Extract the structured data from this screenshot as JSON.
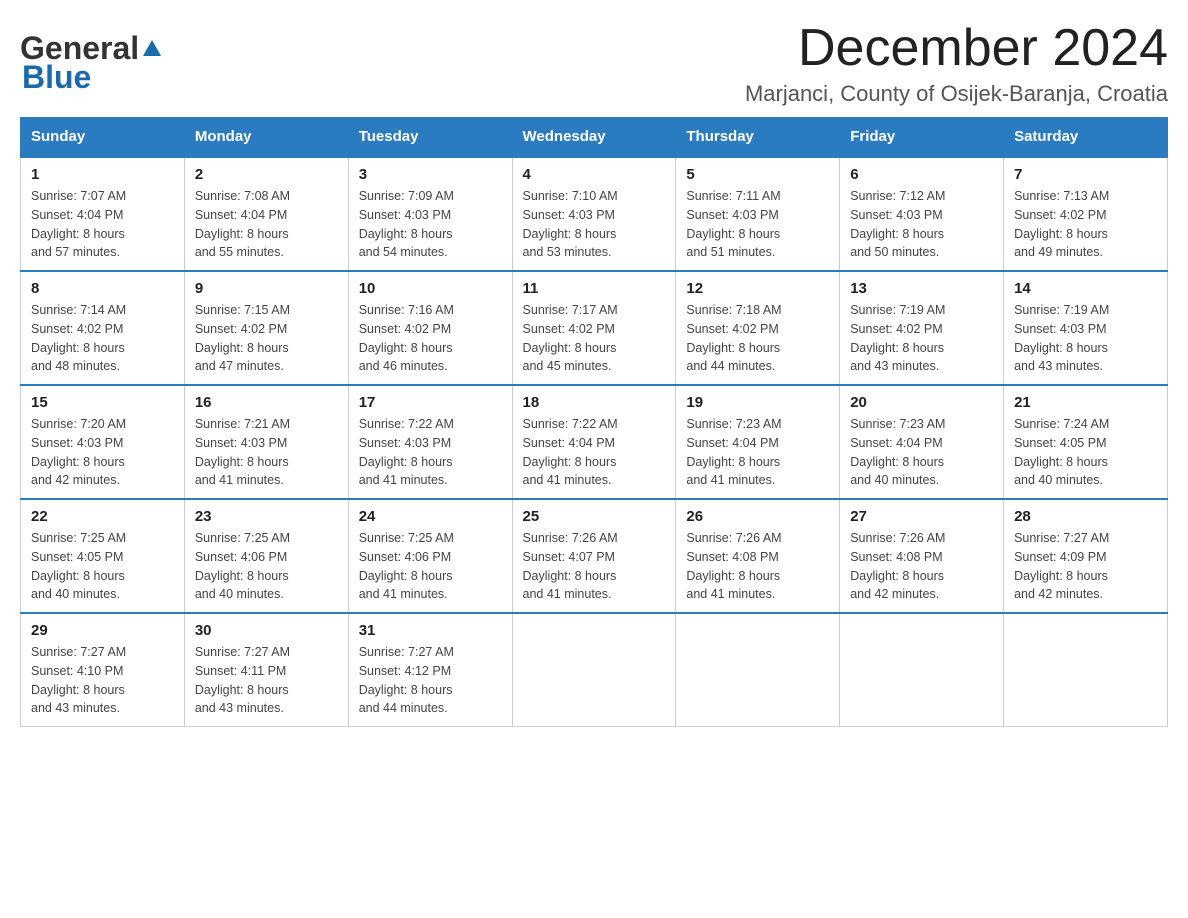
{
  "header": {
    "logo_general": "General",
    "logo_blue": "Blue",
    "month_title": "December 2024",
    "location": "Marjanci, County of Osijek-Baranja, Croatia"
  },
  "days_of_week": [
    "Sunday",
    "Monday",
    "Tuesday",
    "Wednesday",
    "Thursday",
    "Friday",
    "Saturday"
  ],
  "weeks": [
    [
      {
        "day": "1",
        "sunrise": "7:07 AM",
        "sunset": "4:04 PM",
        "daylight": "8 hours and 57 minutes."
      },
      {
        "day": "2",
        "sunrise": "7:08 AM",
        "sunset": "4:04 PM",
        "daylight": "8 hours and 55 minutes."
      },
      {
        "day": "3",
        "sunrise": "7:09 AM",
        "sunset": "4:03 PM",
        "daylight": "8 hours and 54 minutes."
      },
      {
        "day": "4",
        "sunrise": "7:10 AM",
        "sunset": "4:03 PM",
        "daylight": "8 hours and 53 minutes."
      },
      {
        "day": "5",
        "sunrise": "7:11 AM",
        "sunset": "4:03 PM",
        "daylight": "8 hours and 51 minutes."
      },
      {
        "day": "6",
        "sunrise": "7:12 AM",
        "sunset": "4:03 PM",
        "daylight": "8 hours and 50 minutes."
      },
      {
        "day": "7",
        "sunrise": "7:13 AM",
        "sunset": "4:02 PM",
        "daylight": "8 hours and 49 minutes."
      }
    ],
    [
      {
        "day": "8",
        "sunrise": "7:14 AM",
        "sunset": "4:02 PM",
        "daylight": "8 hours and 48 minutes."
      },
      {
        "day": "9",
        "sunrise": "7:15 AM",
        "sunset": "4:02 PM",
        "daylight": "8 hours and 47 minutes."
      },
      {
        "day": "10",
        "sunrise": "7:16 AM",
        "sunset": "4:02 PM",
        "daylight": "8 hours and 46 minutes."
      },
      {
        "day": "11",
        "sunrise": "7:17 AM",
        "sunset": "4:02 PM",
        "daylight": "8 hours and 45 minutes."
      },
      {
        "day": "12",
        "sunrise": "7:18 AM",
        "sunset": "4:02 PM",
        "daylight": "8 hours and 44 minutes."
      },
      {
        "day": "13",
        "sunrise": "7:19 AM",
        "sunset": "4:02 PM",
        "daylight": "8 hours and 43 minutes."
      },
      {
        "day": "14",
        "sunrise": "7:19 AM",
        "sunset": "4:03 PM",
        "daylight": "8 hours and 43 minutes."
      }
    ],
    [
      {
        "day": "15",
        "sunrise": "7:20 AM",
        "sunset": "4:03 PM",
        "daylight": "8 hours and 42 minutes."
      },
      {
        "day": "16",
        "sunrise": "7:21 AM",
        "sunset": "4:03 PM",
        "daylight": "8 hours and 41 minutes."
      },
      {
        "day": "17",
        "sunrise": "7:22 AM",
        "sunset": "4:03 PM",
        "daylight": "8 hours and 41 minutes."
      },
      {
        "day": "18",
        "sunrise": "7:22 AM",
        "sunset": "4:04 PM",
        "daylight": "8 hours and 41 minutes."
      },
      {
        "day": "19",
        "sunrise": "7:23 AM",
        "sunset": "4:04 PM",
        "daylight": "8 hours and 41 minutes."
      },
      {
        "day": "20",
        "sunrise": "7:23 AM",
        "sunset": "4:04 PM",
        "daylight": "8 hours and 40 minutes."
      },
      {
        "day": "21",
        "sunrise": "7:24 AM",
        "sunset": "4:05 PM",
        "daylight": "8 hours and 40 minutes."
      }
    ],
    [
      {
        "day": "22",
        "sunrise": "7:25 AM",
        "sunset": "4:05 PM",
        "daylight": "8 hours and 40 minutes."
      },
      {
        "day": "23",
        "sunrise": "7:25 AM",
        "sunset": "4:06 PM",
        "daylight": "8 hours and 40 minutes."
      },
      {
        "day": "24",
        "sunrise": "7:25 AM",
        "sunset": "4:06 PM",
        "daylight": "8 hours and 41 minutes."
      },
      {
        "day": "25",
        "sunrise": "7:26 AM",
        "sunset": "4:07 PM",
        "daylight": "8 hours and 41 minutes."
      },
      {
        "day": "26",
        "sunrise": "7:26 AM",
        "sunset": "4:08 PM",
        "daylight": "8 hours and 41 minutes."
      },
      {
        "day": "27",
        "sunrise": "7:26 AM",
        "sunset": "4:08 PM",
        "daylight": "8 hours and 42 minutes."
      },
      {
        "day": "28",
        "sunrise": "7:27 AM",
        "sunset": "4:09 PM",
        "daylight": "8 hours and 42 minutes."
      }
    ],
    [
      {
        "day": "29",
        "sunrise": "7:27 AM",
        "sunset": "4:10 PM",
        "daylight": "8 hours and 43 minutes."
      },
      {
        "day": "30",
        "sunrise": "7:27 AM",
        "sunset": "4:11 PM",
        "daylight": "8 hours and 43 minutes."
      },
      {
        "day": "31",
        "sunrise": "7:27 AM",
        "sunset": "4:12 PM",
        "daylight": "8 hours and 44 minutes."
      },
      null,
      null,
      null,
      null
    ]
  ],
  "labels": {
    "sunrise_prefix": "Sunrise: ",
    "sunset_prefix": "Sunset: ",
    "daylight_prefix": "Daylight: "
  }
}
